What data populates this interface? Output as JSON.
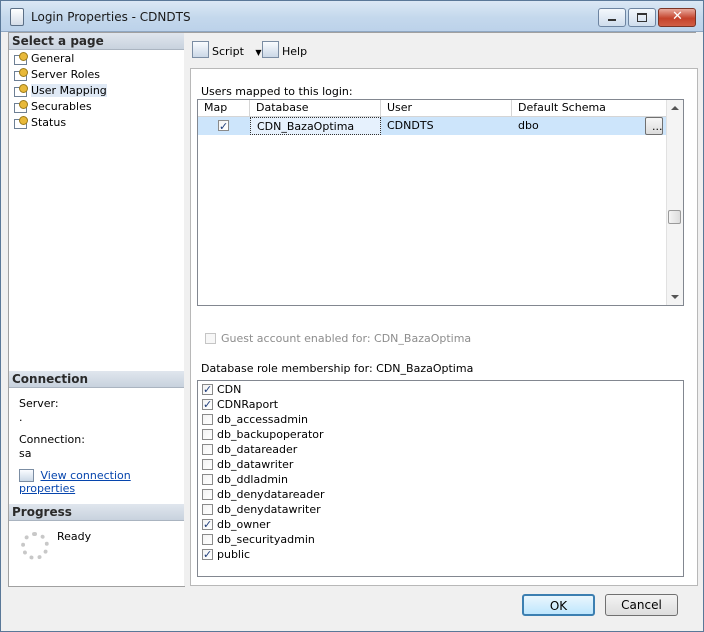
{
  "window": {
    "title": "Login Properties - CDNDTS"
  },
  "left": {
    "select_page_header": "Select a page",
    "pages": [
      {
        "label": "General"
      },
      {
        "label": "Server Roles"
      },
      {
        "label": "User Mapping"
      },
      {
        "label": "Securables"
      },
      {
        "label": "Status"
      }
    ],
    "connection_header": "Connection",
    "server_label": "Server:",
    "server_value": ".",
    "connection_label": "Connection:",
    "connection_value": "sa",
    "view_props_link": "View connection properties",
    "progress_header": "Progress",
    "progress_status": "Ready"
  },
  "toolbar": {
    "script_label": "Script",
    "help_label": "Help"
  },
  "users_mapped": {
    "label": "Users mapped to this login:",
    "columns": [
      "Map",
      "Database",
      "User",
      "Default Schema"
    ],
    "rows": [
      {
        "map": true,
        "database": "CDN_BazaOptima",
        "user": "CDNDTS",
        "schema": "dbo",
        "button": "..."
      }
    ]
  },
  "guest": {
    "label": "Guest account enabled for: CDN_BazaOptima",
    "checked": false
  },
  "roles": {
    "label": "Database role membership for: CDN_BazaOptima",
    "items": [
      {
        "name": "CDN",
        "checked": true
      },
      {
        "name": "CDNRaport",
        "checked": true
      },
      {
        "name": "db_accessadmin",
        "checked": false
      },
      {
        "name": "db_backupoperator",
        "checked": false
      },
      {
        "name": "db_datareader",
        "checked": false
      },
      {
        "name": "db_datawriter",
        "checked": false
      },
      {
        "name": "db_ddladmin",
        "checked": false
      },
      {
        "name": "db_denydatareader",
        "checked": false
      },
      {
        "name": "db_denydatawriter",
        "checked": false
      },
      {
        "name": "db_owner",
        "checked": true
      },
      {
        "name": "db_securityadmin",
        "checked": false
      },
      {
        "name": "public",
        "checked": true
      }
    ]
  },
  "footer": {
    "ok_label": "OK",
    "cancel_label": "Cancel"
  },
  "colors": {
    "accent": "#3c7fb1",
    "selection": "#cde5fb",
    "link": "#0645ad"
  }
}
